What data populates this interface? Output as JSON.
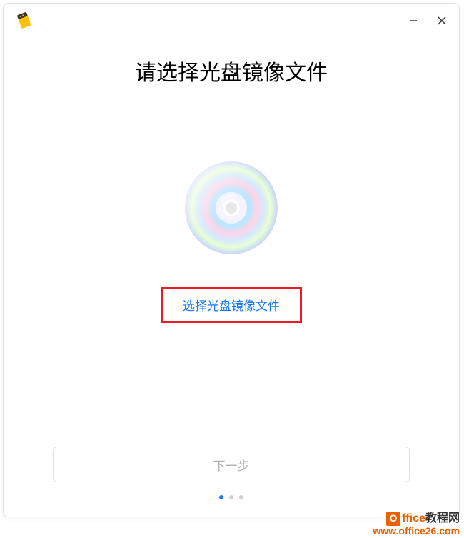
{
  "heading": "请选择光盘镜像文件",
  "selectLink": "选择光盘镜像文件",
  "nextButton": "下一步",
  "watermark": {
    "oLetter": "O",
    "line1a": "ffice",
    "line1b": "教程网",
    "line2": "www.office26.com"
  }
}
